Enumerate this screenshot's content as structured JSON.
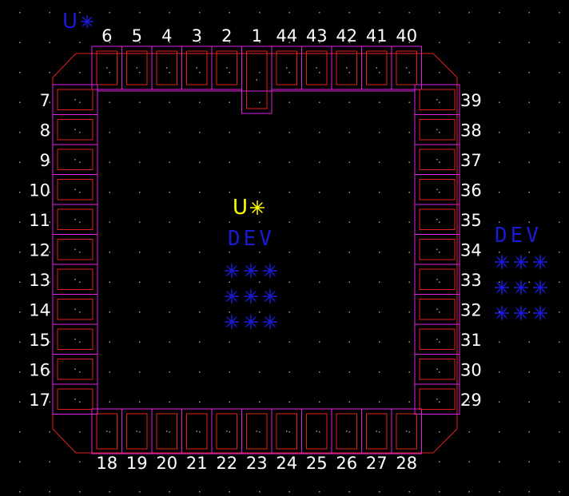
{
  "layer_colors": {
    "background": "#000000",
    "grid_dot": "#9a9a9a",
    "pad_outline": "#e020e0",
    "copper_outline": "#e02020",
    "body_outline": "#e02020",
    "silk_text": "#ffffff",
    "designator": "#ffff00",
    "reference": "#1a1ad6"
  },
  "component": {
    "package": "44-pin square chip carrier, 11 pins per side",
    "top_pins": [
      "6",
      "5",
      "4",
      "3",
      "2",
      "1",
      "44",
      "43",
      "42",
      "41",
      "40"
    ],
    "bottom_pins": [
      "18",
      "19",
      "20",
      "21",
      "22",
      "23",
      "24",
      "25",
      "26",
      "27",
      "28"
    ],
    "left_pins": [
      "7",
      "8",
      "9",
      "10",
      "11",
      "12",
      "13",
      "14",
      "15",
      "16",
      "17"
    ],
    "right_pins": [
      "39",
      "38",
      "37",
      "36",
      "35",
      "34",
      "33",
      "32",
      "31",
      "30",
      "29"
    ],
    "pin1_elongated": true,
    "designator_text": "U",
    "designator_mark": "yellow asterisk origin",
    "value_text": "DEV",
    "placeholder_mark": "***"
  },
  "labels": {
    "origin_designator": "U",
    "center_designator": "U",
    "center_value": "DEV",
    "center_stars": [
      "***",
      "***",
      "***"
    ],
    "side_value": "DEV",
    "side_stars": [
      "***",
      "***",
      "***"
    ]
  }
}
